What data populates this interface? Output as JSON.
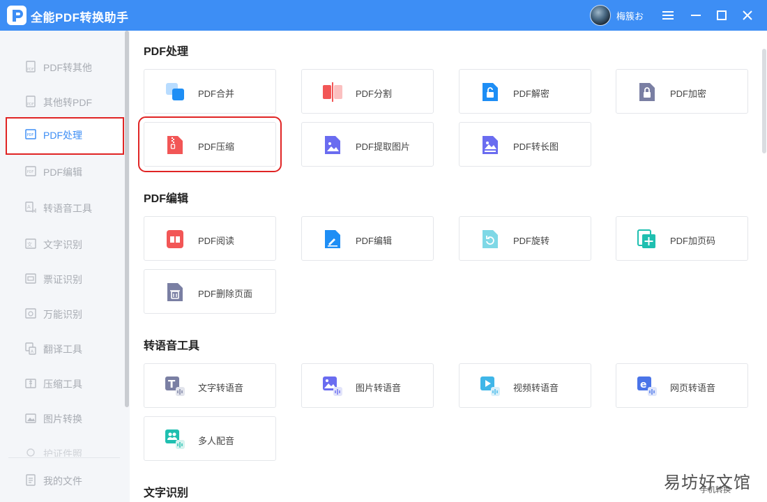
{
  "app": {
    "title": "全能PDF转换助手",
    "username": "梅簇お"
  },
  "sidebar": {
    "items": [
      {
        "label": "PDF转其他",
        "icon": "pdf-doc-icon",
        "active": false
      },
      {
        "label": "其他转PDF",
        "icon": "pdf-doc-icon",
        "active": false
      },
      {
        "label": "PDF处理",
        "icon": "pdf-process-icon",
        "active": true
      },
      {
        "label": "PDF编辑",
        "icon": "pdf-edit-icon",
        "active": false
      },
      {
        "label": "转语音工具",
        "icon": "voice-icon",
        "active": false
      },
      {
        "label": "文字识别",
        "icon": "ocr-icon",
        "active": false
      },
      {
        "label": "票证识别",
        "icon": "ticket-icon",
        "active": false
      },
      {
        "label": "万能识别",
        "icon": "scan-icon",
        "active": false
      },
      {
        "label": "翻译工具",
        "icon": "translate-icon",
        "active": false
      },
      {
        "label": "压缩工具",
        "icon": "compress-icon",
        "active": false
      },
      {
        "label": "图片转换",
        "icon": "image-icon",
        "active": false
      },
      {
        "label": "护证件照",
        "icon": "id-photo-icon",
        "active": false
      }
    ],
    "my_files": "我的文件"
  },
  "sections": [
    {
      "title": "PDF处理",
      "cards": [
        "PDF合并",
        "PDF分割",
        "PDF解密",
        "PDF加密",
        "PDF压缩",
        "PDF提取图片",
        "PDF转长图"
      ]
    },
    {
      "title": "PDF编辑",
      "cards": [
        "PDF阅读",
        "PDF编辑",
        "PDF旋转",
        "PDF加页码",
        "PDF删除页面"
      ]
    },
    {
      "title": "转语音工具",
      "cards": [
        "文字转语音",
        "图片转语音",
        "视频转语音",
        "网页转语音",
        "多人配音"
      ]
    },
    {
      "title": "文字识别",
      "cards": []
    }
  ],
  "watermark": {
    "text": "易坊好文馆",
    "sub": "手机转换"
  },
  "colors": {
    "accent": "#3d8ef5",
    "highlight": "#e02424"
  }
}
